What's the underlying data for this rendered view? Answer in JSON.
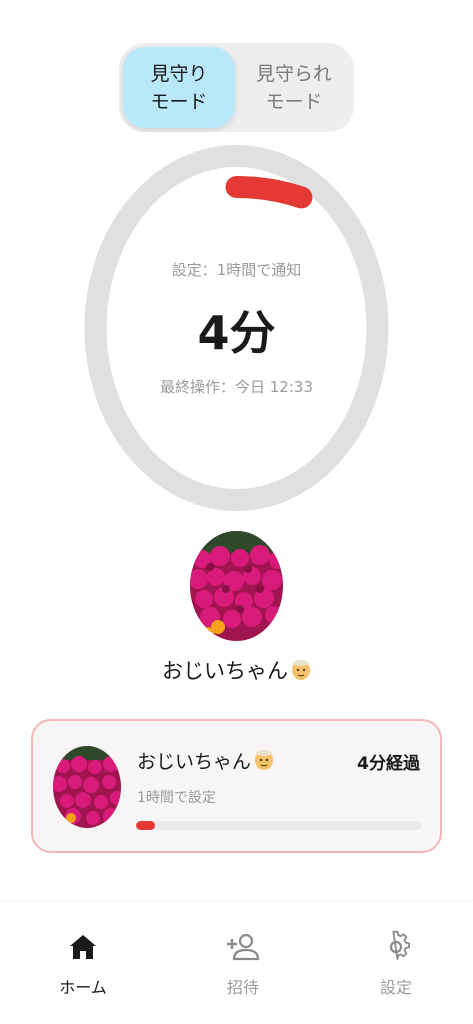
{
  "mode_toggle": {
    "watch_label": "見守り\nモード",
    "watched_label": "見守られ\nモード",
    "selected": "watch"
  },
  "timer": {
    "setting_text": "設定：1時間で通知",
    "elapsed_text": "4分",
    "last_action_text": "最終操作：今日 12:33",
    "progress_fraction": 0.067,
    "ring_color": "#e0e0e0",
    "progress_color": "#e53935"
  },
  "watched_person": {
    "name": "おじいちゃん",
    "emoji_icon": "older-man-face"
  },
  "card": {
    "name": "おじいちゃん",
    "elapsed": "4分経過",
    "setting": "1時間で設定",
    "progress_fraction": 0.067,
    "border_color": "#f2b8b8"
  },
  "bottom_nav": {
    "home_label": "ホーム",
    "invite_label": "招待",
    "settings_label": "設定",
    "active": "home"
  }
}
